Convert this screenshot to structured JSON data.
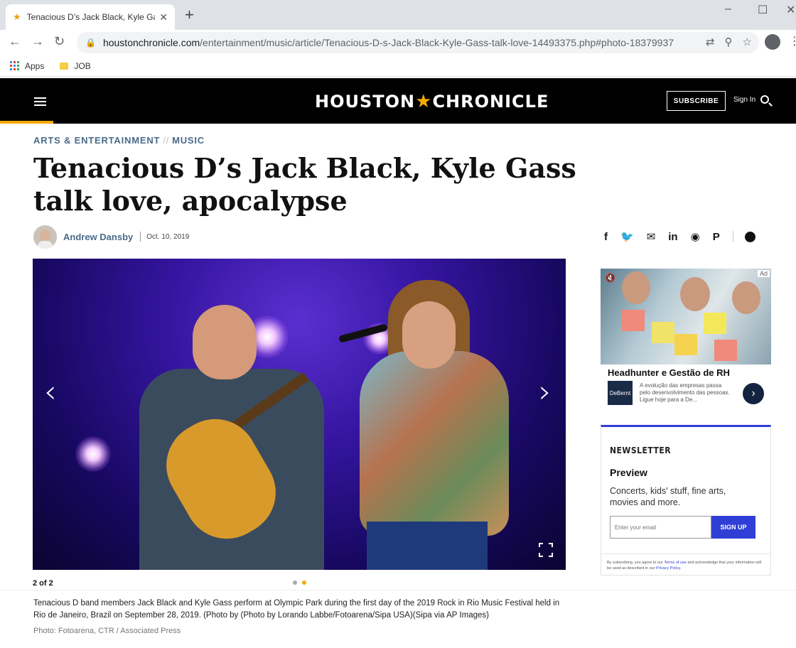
{
  "browser": {
    "tab_title": "Tenacious D’s Jack Black, Kyle Gass talk love, apocalypse",
    "url_host": "houstonchronicle.com",
    "url_path": "/entertainment/music/article/Tenacious-D-s-Jack-Black-Kyle-Gass-talk-love-14493375.php#photo-18379937",
    "bookmarks": [
      "Apps",
      "JOB"
    ]
  },
  "site": {
    "logo_left": "HOUSTON",
    "logo_right": "CHRONICLE",
    "subscribe": "SUBSCRIBE",
    "sign_in": "Sign In"
  },
  "article": {
    "section": "ARTS & ENTERTAINMENT",
    "crumb_sep": "//",
    "subsection": "MUSIC",
    "headline": "Tenacious D’s Jack Black, Kyle Gass talk love, apocalypse",
    "author": "Andrew Dansby",
    "date": "Oct. 10, 2019"
  },
  "share_icons": [
    "facebook-icon",
    "twitter-icon",
    "email-icon",
    "linkedin-icon",
    "reddit-icon",
    "pinterest-icon",
    "comment-icon"
  ],
  "gallery": {
    "counter": "2 of 2",
    "slides": 2,
    "active_slide": 2,
    "caption": "Tenacious D band members Jack Black and Kyle Gass perform at Olympic Park during the first day of the 2019 Rock in Rio Music Festival held in Rio de Janeiro, Brazil on September 28, 2019. (Photo by (Photo by Lorando Labbe/Fotoarena/Sipa USA)(Sipa via AP Images)",
    "credit": "Photo: Fotoarena, CTR / Associated Press"
  },
  "ad": {
    "tag": "Ad",
    "title": "Headhunter e Gestão de RH",
    "logo": "DeBernt",
    "text": "A evolução das empresas passa pelo desenvolvimento das pessoas. Ligue hoje para a De..."
  },
  "newsletter": {
    "heading": "NEWSLETTER",
    "title": "Preview",
    "description": "Concerts, kids' stuff, fine arts, movies and more.",
    "input_placeholder": "Enter your email",
    "button": "SIGN UP",
    "fine_print_1": "By subscribing, you agree to our",
    "terms": "Terms of use",
    "fine_print_2": "and acknowledge that your information will be used as described in our",
    "privacy": "Privacy Policy."
  },
  "colors": {
    "accent": "#f2a900",
    "link": "#4a6b8a",
    "newsletter": "#2f3fd6"
  }
}
